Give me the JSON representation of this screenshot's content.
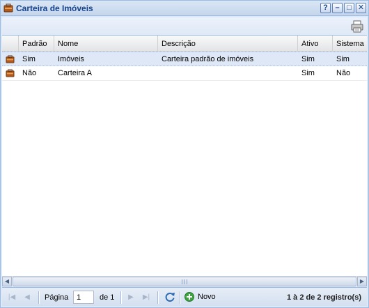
{
  "window": {
    "title": "Carteira de Imóveis",
    "tools": {
      "help": "?",
      "minimize": "–",
      "maximize": "□",
      "close": "✕"
    }
  },
  "grid": {
    "columns": [
      "Padrão",
      "Nome",
      "Descrição",
      "Ativo",
      "Sistema"
    ],
    "rows": [
      {
        "padrao": "Sim",
        "nome": "Imóveis",
        "descricao": "Carteira padrão de imóveis",
        "ativo": "Sim",
        "sistema": "Sim",
        "selected": true
      },
      {
        "padrao": "Não",
        "nome": "Carteira A",
        "descricao": "",
        "ativo": "Sim",
        "sistema": "Não",
        "selected": false
      }
    ]
  },
  "paging": {
    "page_label": "Página",
    "page_value": "1",
    "of_label": "de 1",
    "new_label": "Novo",
    "info": "1 à 2 de 2 registro(s)"
  },
  "colors": {
    "accent": "#15428b",
    "border": "#99bbe8",
    "selected_row": "#dfe8f6"
  }
}
